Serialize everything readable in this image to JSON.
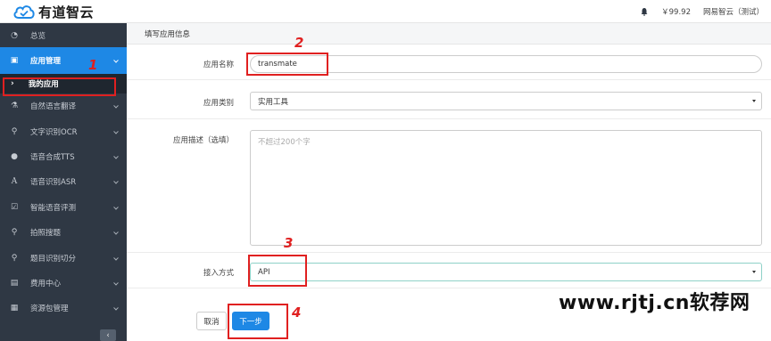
{
  "brand": {
    "name": "有道智云"
  },
  "topbar": {
    "balance": "￥99.92",
    "user": "网易智云（测试）"
  },
  "sidebar": {
    "items": [
      {
        "label": "总览",
        "icon": "dashboard-icon"
      },
      {
        "label": "应用管理",
        "icon": "app-icon"
      },
      {
        "label": "我的应用",
        "icon": "chevron-right-icon"
      },
      {
        "label": "自然语言翻译",
        "icon": "flask-icon"
      },
      {
        "label": "文字识别OCR",
        "icon": "search-icon"
      },
      {
        "label": "语音合成TTS",
        "icon": "microphone-icon"
      },
      {
        "label": "语音识别ASR",
        "icon": "letter-a-icon"
      },
      {
        "label": "智能语音评测",
        "icon": "check-square-icon"
      },
      {
        "label": "拍照搜题",
        "icon": "search-icon"
      },
      {
        "label": "题目识别切分",
        "icon": "search-icon"
      },
      {
        "label": "费用中心",
        "icon": "chart-icon"
      },
      {
        "label": "资源包管理",
        "icon": "package-icon"
      }
    ],
    "collapse": "‹"
  },
  "form": {
    "section_title": "填写应用信息",
    "name_label": "应用名称",
    "name_value": "transmate",
    "category_label": "应用类别",
    "category_value": "实用工具",
    "desc_label": "应用描述（选填）",
    "desc_placeholder": "不超过200个字",
    "access_label": "接入方式",
    "access_value": "API",
    "cancel": "取消",
    "next": "下一步"
  },
  "annotations": [
    "1",
    "2",
    "3",
    "4"
  ],
  "watermark": "www.rjtj.cn软荐网",
  "colors": {
    "sidebar_bg": "#2f3844",
    "active": "#1e88e5",
    "highlight": "#e02020"
  }
}
